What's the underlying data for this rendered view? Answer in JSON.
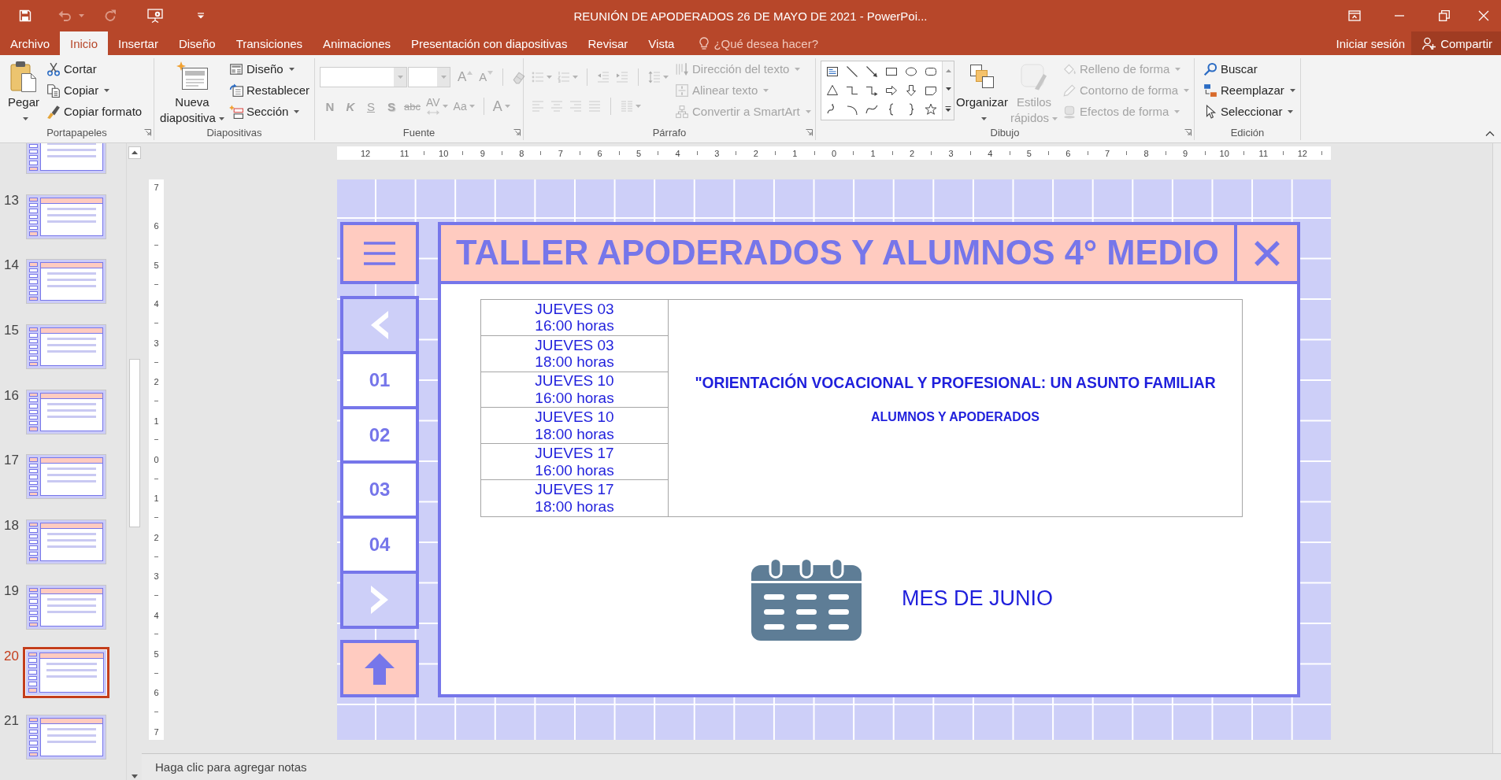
{
  "window": {
    "title": "REUNIÓN DE APODERADOS 26 DE MAYO DE 2021 - PowerPoi..."
  },
  "quick_access": [
    {
      "disabled": false,
      "dropdown": false
    },
    {
      "disabled": true,
      "dropdown": true
    },
    {
      "disabled": true,
      "dropdown": false
    },
    {
      "disabled": false,
      "dropdown": false
    },
    {
      "disabled": false,
      "dropdown": false
    }
  ],
  "tabs": [
    {
      "label": "Archivo",
      "selected": false
    },
    {
      "label": "Inicio",
      "selected": true
    },
    {
      "label": "Insertar",
      "selected": false
    },
    {
      "label": "Diseño",
      "selected": false
    },
    {
      "label": "Transiciones",
      "selected": false
    },
    {
      "label": "Animaciones",
      "selected": false
    },
    {
      "label": "Presentación con diapositivas",
      "selected": false
    },
    {
      "label": "Revisar",
      "selected": false
    },
    {
      "label": "Vista",
      "selected": false
    }
  ],
  "tell_me": {
    "placeholder": "¿Qué desea hacer?"
  },
  "account": {
    "sign_in": "Iniciar sesión",
    "share": "Compartir"
  },
  "ribbon": [
    {
      "label": "Portapapeles",
      "launcher": true,
      "sections": [
        {
          "kind": "large",
          "items": [
            {
              "label": "Pegar",
              "disabled": false,
              "dropdown": true
            }
          ]
        },
        {
          "kind": "stack",
          "items": [
            {
              "label": "Cortar",
              "disabled": false,
              "dropdown": false
            },
            {
              "label": "Copiar",
              "disabled": false,
              "dropdown": true
            },
            {
              "label": "Copiar formato",
              "disabled": false,
              "dropdown": false
            }
          ]
        }
      ]
    },
    {
      "label": "Diapositivas",
      "launcher": false,
      "sections": [
        {
          "kind": "large",
          "items": [
            {
              "label": "Nueva diapositiva",
              "disabled": false,
              "dropdown": true
            }
          ]
        },
        {
          "kind": "stack",
          "items": [
            {
              "label": "Diseño",
              "disabled": false,
              "dropdown": true
            },
            {
              "label": "Restablecer",
              "disabled": false,
              "dropdown": false
            },
            {
              "label": "Sección",
              "disabled": false,
              "dropdown": true
            }
          ]
        }
      ]
    },
    {
      "label": "Fuente",
      "launcher": true,
      "sections": [
        {
          "kind": "rows",
          "rows": [
            {
              "items": [
                {
                  "kind": "combo",
                  "disabled": true
                },
                {
                  "kind": "combo",
                  "disabled": true
                },
                {
                  "kind": "grow",
                  "label": "A",
                  "disabled": true
                },
                {
                  "kind": "shrink",
                  "label": "A",
                  "disabled": true
                },
                {
                  "kind": "icon",
                  "disabled": true,
                  "dropdown": false
                }
              ]
            },
            {
              "items": [
                {
                  "kind": "char",
                  "label": "N",
                  "disabled": true,
                  "dropdown": false
                },
                {
                  "kind": "char",
                  "label": "K",
                  "disabled": true,
                  "dropdown": false
                },
                {
                  "kind": "char",
                  "label": "S",
                  "disabled": true,
                  "dropdown": false
                },
                {
                  "kind": "char",
                  "label": "S",
                  "disabled": true,
                  "dropdown": false
                },
                {
                  "kind": "char",
                  "label": "abc",
                  "disabled": true,
                  "dropdown": false
                },
                {
                  "kind": "char",
                  "label": "AV",
                  "disabled": true,
                  "dropdown": true
                },
                {
                  "kind": "char",
                  "label": "Aa",
                  "disabled": true,
                  "dropdown": true
                },
                {
                  "kind": "char",
                  "label": "A",
                  "disabled": true,
                  "dropdown": true
                }
              ]
            }
          ]
        }
      ]
    },
    {
      "label": "Párrafo",
      "launcher": true,
      "sections": [
        {
          "kind": "rows",
          "rows": [
            {
              "items": [
                {
                  "kind": "icon",
                  "disabled": true,
                  "dropdown": true
                },
                {
                  "kind": "icon",
                  "disabled": true,
                  "dropdown": true
                },
                {
                  "kind": "icon",
                  "disabled": true,
                  "dropdown": false
                },
                {
                  "kind": "icon",
                  "disabled": true,
                  "dropdown": false
                },
                {
                  "kind": "icon",
                  "disabled": true,
                  "dropdown": true
                }
              ]
            },
            {
              "items": [
                {
                  "kind": "icon",
                  "disabled": true,
                  "dropdown": false
                },
                {
                  "kind": "icon",
                  "disabled": true,
                  "dropdown": false
                },
                {
                  "kind": "icon",
                  "disabled": true,
                  "dropdown": false
                },
                {
                  "kind": "icon",
                  "disabled": true,
                  "dropdown": false
                },
                {
                  "kind": "icon",
                  "disabled": true,
                  "dropdown": true
                }
              ]
            }
          ]
        },
        {
          "kind": "stack",
          "items": [
            {
              "label": "Dirección del texto",
              "disabled": true,
              "dropdown": true
            },
            {
              "label": "Alinear texto",
              "disabled": true,
              "dropdown": true
            },
            {
              "label": "Convertir a SmartArt",
              "disabled": true,
              "dropdown": true
            }
          ]
        }
      ]
    },
    {
      "label": "Dibujo",
      "launcher": true,
      "sections": [
        {
          "kind": "gallery"
        },
        {
          "kind": "large",
          "items": [
            {
              "label": "Organizar",
              "disabled": false,
              "dropdown": true
            }
          ]
        },
        {
          "kind": "large",
          "items": [
            {
              "label": "Estilos rápidos",
              "disabled": true,
              "dropdown": true
            }
          ]
        },
        {
          "kind": "stack",
          "items": [
            {
              "label": "Relleno de forma",
              "disabled": true,
              "dropdown": true
            },
            {
              "label": "Contorno de forma",
              "disabled": true,
              "dropdown": true
            },
            {
              "label": "Efectos de forma",
              "disabled": true,
              "dropdown": true
            }
          ]
        }
      ]
    },
    {
      "label": "Edición",
      "launcher": false,
      "sections": [
        {
          "kind": "stack",
          "items": [
            {
              "label": "Buscar",
              "disabled": false,
              "dropdown": false
            },
            {
              "label": "Reemplazar",
              "disabled": false,
              "dropdown": true
            },
            {
              "label": "Seleccionar",
              "disabled": false,
              "dropdown": true
            }
          ]
        }
      ]
    }
  ],
  "thumbnails": [
    {
      "selected": false
    },
    {
      "number": "13",
      "selected": false
    },
    {
      "number": "14",
      "selected": false
    },
    {
      "number": "15",
      "selected": false
    },
    {
      "number": "16",
      "selected": false
    },
    {
      "number": "17",
      "selected": false
    },
    {
      "number": "18",
      "selected": false
    },
    {
      "number": "19",
      "selected": false
    },
    {
      "number": "20",
      "selected": true
    },
    {
      "number": "21",
      "selected": false
    }
  ],
  "rulers": {
    "horizontal": [
      "12",
      "11",
      "10",
      "9",
      "8",
      "7",
      "6",
      "5",
      "4",
      "3",
      "2",
      "1",
      "0",
      "1",
      "2",
      "3",
      "4",
      "5",
      "6",
      "7",
      "8",
      "9",
      "10",
      "11",
      "12"
    ],
    "vertical": [
      "7",
      "6",
      "5",
      "4",
      "3",
      "2",
      "1",
      "0",
      "1",
      "2",
      "3",
      "4",
      "5",
      "6",
      "7"
    ]
  },
  "slide": {
    "title": "TALLER APODERADOS Y ALUMNOS 4° MEDIO",
    "nav": [
      {
        "kind": "prev"
      },
      {
        "kind": "page",
        "label": "01"
      },
      {
        "kind": "page",
        "label": "02"
      },
      {
        "kind": "page",
        "label": "03"
      },
      {
        "kind": "page",
        "label": "04"
      },
      {
        "kind": "next"
      }
    ],
    "table": {
      "rows": [
        {
          "day": "JUEVES 03",
          "time": "16:00 horas"
        },
        {
          "day": "JUEVES 03",
          "time": "18:00 horas"
        },
        {
          "day": "JUEVES 10",
          "time": "16:00 horas"
        },
        {
          "day": "JUEVES 10",
          "time": "18:00 horas"
        },
        {
          "day": "JUEVES 17",
          "time": "16:00 horas"
        },
        {
          "day": "JUEVES 17",
          "time": "18:00 horas"
        }
      ],
      "event": "\"ORIENTACIÓN VOCACIONAL Y PROFESIONAL: UN ASUNTO FAMILIAR",
      "audience": "ALUMNOS Y APODERADOS"
    },
    "month": "MES DE JUNIO"
  },
  "notes": {
    "placeholder": "Haga clic para agregar notas"
  }
}
